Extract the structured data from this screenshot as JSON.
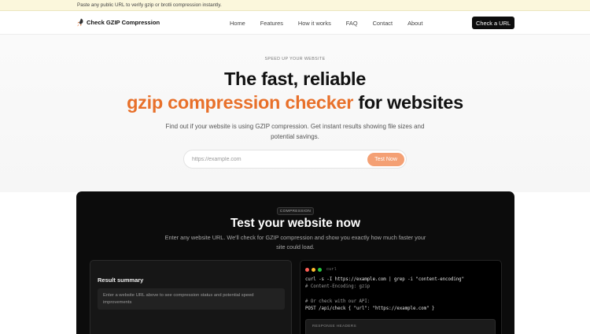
{
  "announcement": "Paste any public URL to verify gzip or brotli compression instantly.",
  "nav": {
    "brand": "Check GZIP Compression",
    "links": [
      "Home",
      "Features",
      "How it works",
      "FAQ",
      "Contact",
      "About"
    ],
    "cta": "Check a URL"
  },
  "hero": {
    "eyebrow": "SPEED UP YOUR WEBSITE",
    "title_line1": "The fast, reliable",
    "title_accent": "gzip compression checker",
    "title_rest": " for websites",
    "subtitle": "Find out if your website is using GZIP compression. Get instant results showing file sizes and potential savings.",
    "search_placeholder": "https://example.com",
    "search_button": "Test Now",
    "accent_color": "#e8702a"
  },
  "panel": {
    "badge": "COMPRESSION",
    "title": "Test your website now",
    "subtitle": "Enter any website URL. We'll check for GZIP compression and show you exactly how much faster your site could load.",
    "result": {
      "heading": "Result summary",
      "empty_text": "Enter a website URL above to see compression status and potential speed improvements"
    },
    "terminal": {
      "label": "curl",
      "line1": "curl -s -I https://example.com | grep -i \"content-encoding\"",
      "line2": "# Content-Encoding: gzip",
      "line3": "# Or check with our API:",
      "line4": "POST /api/check { \"url\": \"https://example.com\" }",
      "headers_label": "RESPONSE HEADERS"
    }
  }
}
